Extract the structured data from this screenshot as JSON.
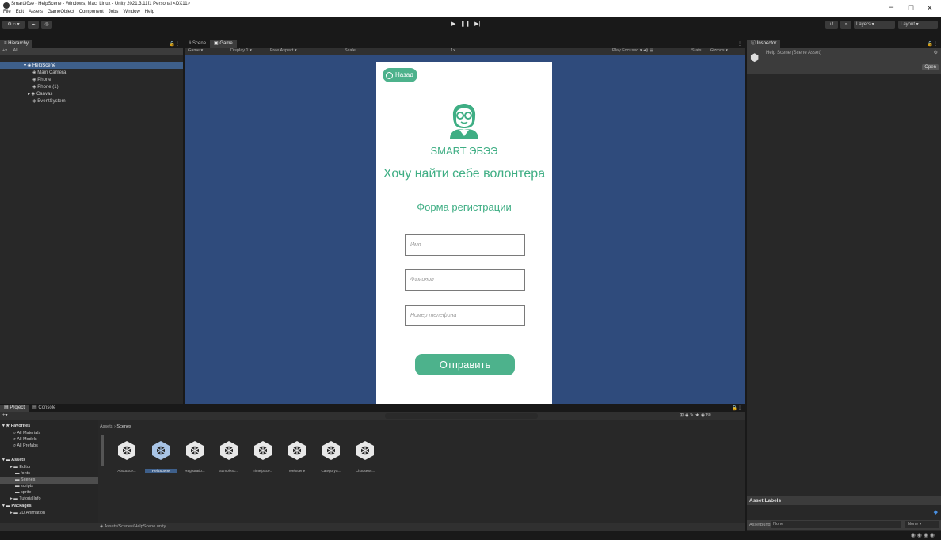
{
  "window": {
    "title": "Smart3бээ - HelpScene - Windows, Mac, Linux - Unity 2021.3.11f1 Personal <DX11>",
    "menu": [
      "File",
      "Edit",
      "Assets",
      "GameObject",
      "Component",
      "Jobs",
      "Window",
      "Help"
    ],
    "controls": [
      "–",
      "☐",
      "✕"
    ]
  },
  "toolbar": {
    "layers_label": "Layers",
    "layout_label": "Layout"
  },
  "hierarchy": {
    "tab": "Hierarchy",
    "search_placeholder": "All",
    "scene": "HelpScene",
    "items": [
      "Main Camera",
      "Phone",
      "Phone (1)",
      "Canvas",
      "EventSystem"
    ]
  },
  "views": {
    "scene_tab": "Scene",
    "game_tab": "Game",
    "game_toolbar": {
      "mode": "Game",
      "display": "Display 1",
      "aspect": "Free Aspect",
      "scale_label": "Scale",
      "scale_value": "1x",
      "play_focused": "Play Focused",
      "stats": "Stats",
      "gizmos": "Gizmos"
    }
  },
  "phone": {
    "back_label": "Назад",
    "brand": "SMART ЭБЭЭ",
    "heading": "Хочу найти себе волонтера",
    "subheading": "Форма регистрации",
    "fields": [
      "Имя",
      "Фамилия",
      "Номер телефона"
    ],
    "submit": "Отправить",
    "accent": "#4db28c"
  },
  "inspector": {
    "tab": "Inspector",
    "asset_title": "Help Scene (Scene Asset)",
    "open_label": "Open",
    "asset_labels": "Asset Labels",
    "asset_bundle_label": "AssetBundle",
    "asset_bundle_value": "None",
    "asset_variant_value": "None"
  },
  "project": {
    "tabs": [
      "Project",
      "Console"
    ],
    "favorites_header": "Favorites",
    "favorites": [
      "All Materials",
      "All Models",
      "All Prefabs"
    ],
    "assets_header": "Assets",
    "folders": [
      "Editor",
      "fonts",
      "Scenes",
      "scripts",
      "sprite",
      "TutorialInfo"
    ],
    "packages_header": "Packages",
    "packages": [
      "2D Animation"
    ],
    "breadcrumb_root": "Assets",
    "breadcrumb_current": "Scenes",
    "assets": [
      "AboutSce...",
      "HelpScene",
      "Registratio...",
      "SampleSc...",
      "TimelpSce...",
      "WelScene",
      "CategoryS...",
      "ChooseSc..."
    ],
    "selected_asset": "HelpScene",
    "status_path": "Assets/Scenes/HelpScene.unity",
    "item_count": "19"
  }
}
